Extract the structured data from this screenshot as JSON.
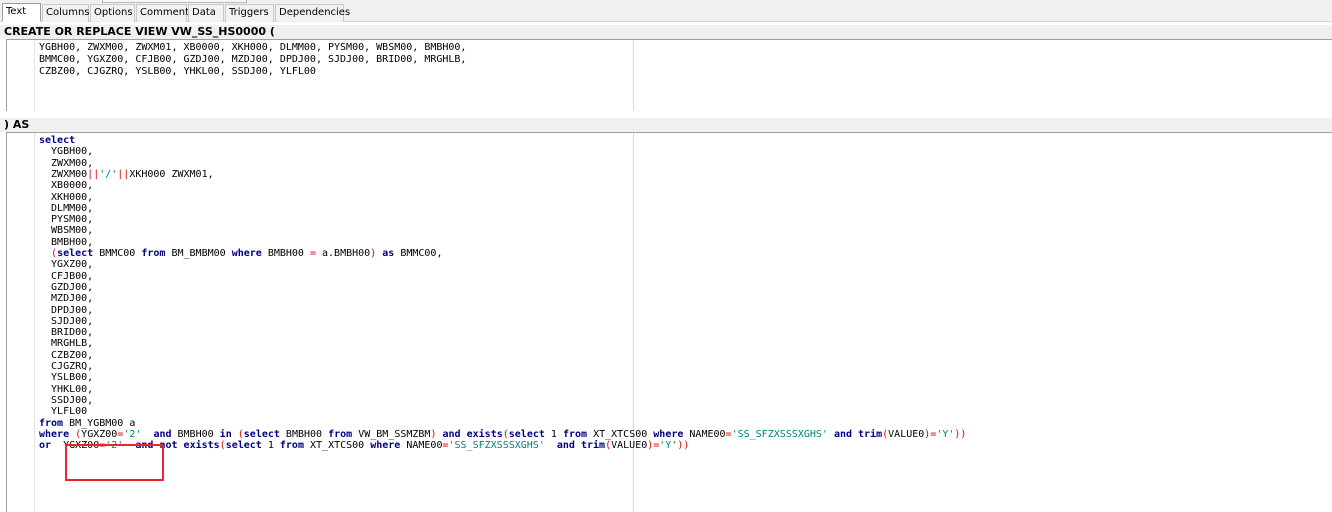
{
  "tabs": [
    "Text",
    "Columns",
    "Options",
    "Comment",
    "Data",
    "Triggers",
    "Dependencies"
  ],
  "header_create": "CREATE OR REPLACE VIEW VW_SS_HS0000 (",
  "header_as": ") AS",
  "columns_lines": [
    "YGBH00, ZWXM00, ZWXM01, XB0000, XKH000, DLMM00, PYSM00, WBSM00, BMBH00,",
    "BMMC00, YGXZ00, CFJB00, GZDJ00, MZDJ00, DPDJ00, SJDJ00, BRID00, MRGHLB,",
    "CZBZ00, CJGZRQ, YSLB00, YHKL00, SSDJ00, YLFL00"
  ],
  "sql_lines": [
    [
      {
        "t": "select",
        "c": "kw"
      }
    ],
    [
      {
        "t": "  YGBH00,"
      }
    ],
    [
      {
        "t": "  ZWXM00,"
      }
    ],
    [
      {
        "t": "  ZWXM00"
      },
      {
        "t": "||",
        "c": "op"
      },
      {
        "t": "'/'",
        "c": "str"
      },
      {
        "t": "||",
        "c": "op"
      },
      {
        "t": "XKH000 ZWXM01,"
      }
    ],
    [
      {
        "t": "  XB0000,"
      }
    ],
    [
      {
        "t": "  XKH000,"
      }
    ],
    [
      {
        "t": "  DLMM00,"
      }
    ],
    [
      {
        "t": "  PYSM00,"
      }
    ],
    [
      {
        "t": "  WBSM00,"
      }
    ],
    [
      {
        "t": "  BMBH00,"
      }
    ],
    [
      {
        "t": "  (",
        "c": "op"
      },
      {
        "t": "select",
        "c": "kw"
      },
      {
        "t": " BMMC00 "
      },
      {
        "t": "from",
        "c": "kw"
      },
      {
        "t": " BM_BMBM00 "
      },
      {
        "t": "where",
        "c": "kw"
      },
      {
        "t": " BMBH00 "
      },
      {
        "t": "=",
        "c": "op"
      },
      {
        "t": " a.BMBH00"
      },
      {
        "t": ")",
        "c": "op"
      },
      {
        "t": " "
      },
      {
        "t": "as",
        "c": "kw"
      },
      {
        "t": " BMMC00,"
      }
    ],
    [
      {
        "t": "  YGXZ00,"
      }
    ],
    [
      {
        "t": "  CFJB00,"
      }
    ],
    [
      {
        "t": "  GZDJ00,"
      }
    ],
    [
      {
        "t": "  MZDJ00,"
      }
    ],
    [
      {
        "t": "  DPDJ00,"
      }
    ],
    [
      {
        "t": "  SJDJ00,"
      }
    ],
    [
      {
        "t": "  BRID00,"
      }
    ],
    [
      {
        "t": "  MRGHLB,"
      }
    ],
    [
      {
        "t": "  CZBZ00,"
      }
    ],
    [
      {
        "t": "  CJGZRQ,"
      }
    ],
    [
      {
        "t": "  YSLB00,"
      }
    ],
    [
      {
        "t": "  YHKL00,"
      }
    ],
    [
      {
        "t": "  SSDJ00,"
      }
    ],
    [
      {
        "t": "  YLFL00"
      }
    ],
    [
      {
        "t": "from",
        "c": "kw"
      },
      {
        "t": " BM_YGBM00 a"
      }
    ],
    [
      {
        "t": "where",
        "c": "kw"
      },
      {
        "t": " "
      },
      {
        "t": "(",
        "c": "op"
      },
      {
        "t": "YGXZ00"
      },
      {
        "t": "=",
        "c": "op"
      },
      {
        "t": "'2'",
        "c": "str"
      },
      {
        "t": "  "
      },
      {
        "t": "and",
        "c": "kw"
      },
      {
        "t": " BMBH00 "
      },
      {
        "t": "in",
        "c": "kw"
      },
      {
        "t": " "
      },
      {
        "t": "(",
        "c": "op"
      },
      {
        "t": "select",
        "c": "kw"
      },
      {
        "t": " BMBH00 "
      },
      {
        "t": "from",
        "c": "kw"
      },
      {
        "t": " VW_BM_SSMZBM"
      },
      {
        "t": ")",
        "c": "op"
      },
      {
        "t": " "
      },
      {
        "t": "and",
        "c": "kw"
      },
      {
        "t": " "
      },
      {
        "t": "exists",
        "c": "kw"
      },
      {
        "t": "(",
        "c": "op"
      },
      {
        "t": "select",
        "c": "kw"
      },
      {
        "t": " 1 "
      },
      {
        "t": "from",
        "c": "kw"
      },
      {
        "t": " XT_XTCS00 "
      },
      {
        "t": "where",
        "c": "kw"
      },
      {
        "t": " NAME00"
      },
      {
        "t": "=",
        "c": "op"
      },
      {
        "t": "'SS_SFZXSSSXGHS'",
        "c": "str"
      },
      {
        "t": " "
      },
      {
        "t": "and",
        "c": "kw"
      },
      {
        "t": " "
      },
      {
        "t": "trim",
        "c": "kw"
      },
      {
        "t": "(",
        "c": "op"
      },
      {
        "t": "VALUE0"
      },
      {
        "t": ")=",
        "c": "op"
      },
      {
        "t": "'Y'",
        "c": "str"
      },
      {
        "t": "))",
        "c": "op"
      }
    ],
    [
      {
        "t": "or",
        "c": "kw"
      },
      {
        "t": "  YGXZ00"
      },
      {
        "t": "=",
        "c": "op"
      },
      {
        "t": "'2'",
        "c": "str"
      },
      {
        "t": "  "
      },
      {
        "t": "and",
        "c": "kw"
      },
      {
        "t": " "
      },
      {
        "t": "not",
        "c": "kw"
      },
      {
        "t": " "
      },
      {
        "t": "exists",
        "c": "kw"
      },
      {
        "t": "(",
        "c": "op"
      },
      {
        "t": "select",
        "c": "kw"
      },
      {
        "t": " 1 "
      },
      {
        "t": "from",
        "c": "kw"
      },
      {
        "t": " XT_XTCS00 "
      },
      {
        "t": "where",
        "c": "kw"
      },
      {
        "t": " NAME00"
      },
      {
        "t": "=",
        "c": "op"
      },
      {
        "t": "'SS_SFZXSSSXGHS'",
        "c": "str"
      },
      {
        "t": "  "
      },
      {
        "t": "and",
        "c": "kw"
      },
      {
        "t": " "
      },
      {
        "t": "trim",
        "c": "kw"
      },
      {
        "t": "(",
        "c": "op"
      },
      {
        "t": "VALUE0"
      },
      {
        "t": ")=",
        "c": "op"
      },
      {
        "t": "'Y'",
        "c": "str"
      },
      {
        "t": "))",
        "c": "op"
      }
    ]
  ],
  "highlight_color": "#e8262b"
}
